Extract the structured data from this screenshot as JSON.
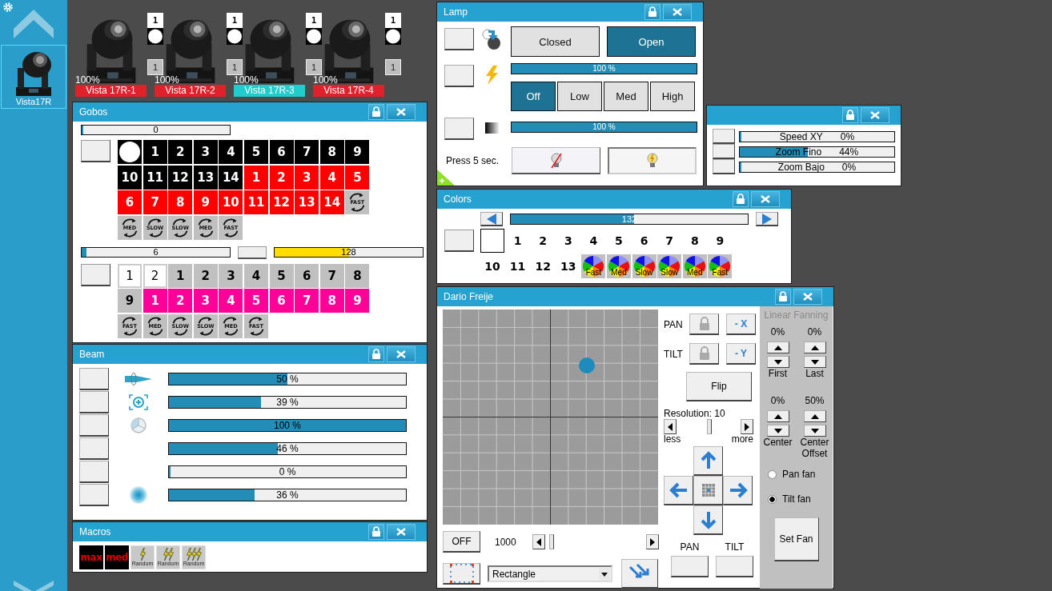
{
  "sidebar": {
    "thumbnail": {
      "label": "Vista17R",
      "selected": true
    }
  },
  "fixtures": [
    {
      "label": "Vista 17R-1",
      "intensity": "100%",
      "gobo": "1",
      "slot": "1",
      "selected": false
    },
    {
      "label": "Vista 17R-2",
      "intensity": "100%",
      "gobo": "1",
      "slot": "1",
      "selected": false
    },
    {
      "label": "Vista 17R-3",
      "intensity": "100%",
      "gobo": "1",
      "slot": "1",
      "selected": true
    },
    {
      "label": "Vista 17R-4",
      "intensity": "100%",
      "gobo": "1",
      "slot": "1",
      "selected": false
    }
  ],
  "gobos": {
    "title": "Gobos",
    "wheel": {
      "reading": "0",
      "level": 0
    },
    "slots": [
      {
        "kind": "open"
      },
      {
        "kind": "number",
        "label": "1",
        "color": "#000000"
      },
      {
        "kind": "number",
        "label": "2",
        "color": "#000000"
      },
      {
        "kind": "number",
        "label": "3",
        "color": "#000000"
      },
      {
        "kind": "number",
        "label": "4",
        "color": "#000000"
      },
      {
        "kind": "number",
        "label": "5",
        "color": "#000000"
      },
      {
        "kind": "number",
        "label": "6",
        "color": "#000000"
      },
      {
        "kind": "number",
        "label": "7",
        "color": "#000000"
      },
      {
        "kind": "number",
        "label": "8",
        "color": "#000000"
      },
      {
        "kind": "number",
        "label": "9",
        "color": "#000000"
      },
      {
        "kind": "number",
        "label": "10",
        "color": "#000000"
      },
      {
        "kind": "number",
        "label": "11",
        "color": "#000000"
      },
      {
        "kind": "number",
        "label": "12",
        "color": "#000000"
      },
      {
        "kind": "number",
        "label": "13",
        "color": "#000000"
      },
      {
        "kind": "number",
        "label": "14",
        "color": "#000000"
      },
      {
        "kind": "number",
        "label": "1",
        "color": "#ff0000"
      },
      {
        "kind": "number",
        "label": "2",
        "color": "#ff0000"
      },
      {
        "kind": "number",
        "label": "3",
        "color": "#ff0000"
      },
      {
        "kind": "number",
        "label": "4",
        "color": "#ff0000"
      },
      {
        "kind": "number",
        "label": "5",
        "color": "#ff0000"
      },
      {
        "kind": "number",
        "label": "6",
        "color": "#ff0000"
      },
      {
        "kind": "number",
        "label": "7",
        "color": "#ff0000"
      },
      {
        "kind": "number",
        "label": "8",
        "color": "#ff0000"
      },
      {
        "kind": "number",
        "label": "9",
        "color": "#ff0000"
      },
      {
        "kind": "number",
        "label": "10",
        "color": "#ff0000"
      },
      {
        "kind": "number",
        "label": "11",
        "color": "#ff0000"
      },
      {
        "kind": "number",
        "label": "12",
        "color": "#ff0000"
      },
      {
        "kind": "number",
        "label": "13",
        "color": "#ff0000"
      },
      {
        "kind": "number",
        "label": "14",
        "color": "#ff0000"
      },
      {
        "kind": "rotation",
        "label": "FAST"
      },
      {
        "kind": "rotation",
        "label": "MED"
      },
      {
        "kind": "rotation",
        "label": "SLOW"
      },
      {
        "kind": "rotation",
        "label": "SLOW"
      },
      {
        "kind": "rotation",
        "label": "MED"
      },
      {
        "kind": "rotation",
        "label": "FAST"
      }
    ],
    "wheel2": {
      "reading": "6",
      "level": 0.03
    },
    "rotation": {
      "reading": "128",
      "level": 0.5
    },
    "slots2": [
      {
        "kind": "number",
        "label": "1",
        "color": "#ffffff"
      },
      {
        "kind": "number",
        "label": "2",
        "color": "#ffffff"
      },
      {
        "kind": "number",
        "label": "1",
        "color": "#c0c0c0"
      },
      {
        "kind": "number",
        "label": "2",
        "color": "#c0c0c0"
      },
      {
        "kind": "number",
        "label": "3",
        "color": "#c0c0c0"
      },
      {
        "kind": "number",
        "label": "4",
        "color": "#c0c0c0"
      },
      {
        "kind": "number",
        "label": "5",
        "color": "#c0c0c0"
      },
      {
        "kind": "number",
        "label": "6",
        "color": "#c0c0c0"
      },
      {
        "kind": "number",
        "label": "7",
        "color": "#c0c0c0"
      },
      {
        "kind": "number",
        "label": "8",
        "color": "#c0c0c0"
      },
      {
        "kind": "number",
        "label": "9",
        "color": "#c0c0c0"
      },
      {
        "kind": "number",
        "label": "1",
        "color": "#ff0099"
      },
      {
        "kind": "number",
        "label": "2",
        "color": "#ff0099"
      },
      {
        "kind": "number",
        "label": "3",
        "color": "#ff0099"
      },
      {
        "kind": "number",
        "label": "4",
        "color": "#ff0099"
      },
      {
        "kind": "number",
        "label": "5",
        "color": "#ff0099"
      },
      {
        "kind": "number",
        "label": "6",
        "color": "#ff0099"
      },
      {
        "kind": "number",
        "label": "7",
        "color": "#ff0099"
      },
      {
        "kind": "number",
        "label": "8",
        "color": "#ff0099"
      },
      {
        "kind": "number",
        "label": "9",
        "color": "#ff0099"
      },
      {
        "kind": "rotation",
        "label": "FAST"
      },
      {
        "kind": "rotation",
        "label": "MED"
      },
      {
        "kind": "rotation",
        "label": "SLOW"
      },
      {
        "kind": "rotation",
        "label": "SLOW"
      },
      {
        "kind": "rotation",
        "label": "MED"
      },
      {
        "kind": "rotation",
        "label": "FAST"
      }
    ]
  },
  "beam": {
    "title": "Beam",
    "rows": [
      {
        "kind": "zoom",
        "reading": "50 %",
        "level": 0.5
      },
      {
        "kind": "focus",
        "reading": "39 %",
        "level": 0.39
      },
      {
        "kind": "prism",
        "reading": "100 %",
        "level": 1
      },
      {
        "kind": "plain",
        "reading": "46 %",
        "level": 0.46
      },
      {
        "kind": "plain",
        "reading": "0 %",
        "level": 0
      },
      {
        "kind": "frost",
        "reading": "36 %",
        "level": 0.36
      }
    ]
  },
  "macros": {
    "title": "Macros",
    "items": [
      {
        "kind": "text",
        "label": "max"
      },
      {
        "kind": "text",
        "label": "med"
      },
      {
        "kind": "random-1",
        "label": "Random"
      },
      {
        "kind": "random-2",
        "label": "Random"
      },
      {
        "kind": "random-3",
        "label": "Random"
      }
    ]
  },
  "lamp": {
    "title": "Lamp",
    "shutter": [
      {
        "label": "Closed",
        "selected": false
      },
      {
        "label": "Open",
        "selected": true
      }
    ],
    "dimmer": {
      "reading": "100 %",
      "level": 1
    },
    "power": [
      {
        "label": "Off",
        "selected": true
      },
      {
        "label": "Low",
        "selected": false
      },
      {
        "label": "Med",
        "selected": false
      },
      {
        "label": "High",
        "selected": false
      }
    ],
    "fade": {
      "reading": "100 %",
      "level": 1
    },
    "hint": "Press 5 sec."
  },
  "speeds": {
    "rows": [
      {
        "label": "Speed XY",
        "reading": "0%",
        "level": 0
      },
      {
        "label": "Zoom Fino",
        "reading": "44%",
        "level": 0.44
      },
      {
        "label": "Zoom Bajo",
        "reading": "0%",
        "level": 0
      }
    ]
  },
  "colors": {
    "title": "Colors",
    "wheel": {
      "reading": "132",
      "level": 0.52
    },
    "slots": [
      {
        "kind": "open"
      },
      {
        "kind": "number",
        "label": "1"
      },
      {
        "kind": "number",
        "label": "2"
      },
      {
        "kind": "number",
        "label": "3"
      },
      {
        "kind": "number",
        "label": "4"
      },
      {
        "kind": "number",
        "label": "5"
      },
      {
        "kind": "number",
        "label": "6"
      },
      {
        "kind": "number",
        "label": "7"
      },
      {
        "kind": "number",
        "label": "8"
      },
      {
        "kind": "number",
        "label": "9"
      },
      {
        "kind": "number",
        "label": "10"
      },
      {
        "kind": "number",
        "label": "11"
      },
      {
        "kind": "number",
        "label": "12"
      },
      {
        "kind": "number",
        "label": "13"
      },
      {
        "kind": "rotation",
        "label": "Fast"
      },
      {
        "kind": "rotation",
        "label": "Med"
      },
      {
        "kind": "rotation",
        "label": "Slow"
      },
      {
        "kind": "rotation",
        "label": "Slow"
      },
      {
        "kind": "rotation",
        "label": "Med"
      },
      {
        "kind": "rotation",
        "label": "Fast"
      }
    ]
  },
  "pan_tilt": {
    "title": "Dario Freije",
    "pan_label": "PAN",
    "pan_invert": "- X",
    "tilt_label": "TILT",
    "tilt_invert": "- Y",
    "flip": "Flip",
    "resolution": {
      "label": "Resolution: 10",
      "less": "less",
      "more": "more"
    },
    "off": "OFF",
    "speed": {
      "reading": "1000"
    },
    "shape": "Rectangle",
    "fields": [
      {
        "label": "PAN"
      },
      {
        "label": "TILT"
      }
    ]
  },
  "fanning": {
    "title": "Linear Fanning",
    "disabled": true,
    "spinner_values": [
      "0%",
      "0%",
      "0%",
      "50%"
    ],
    "spinner_labels": [
      "First",
      "Last",
      "Center",
      "Center Offset"
    ],
    "modes": [
      {
        "label": "Pan fan",
        "selected": false
      },
      {
        "label": "Tilt fan",
        "selected": true
      }
    ],
    "button": "Set Fan"
  }
}
